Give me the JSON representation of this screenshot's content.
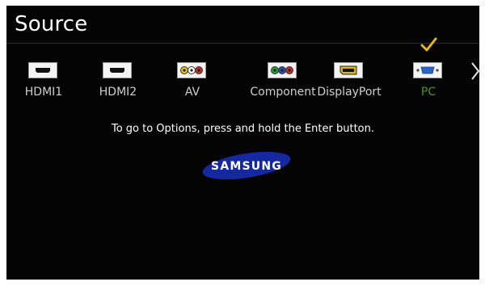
{
  "app": {
    "title": "Source"
  },
  "sources": [
    {
      "label": "HDMI1",
      "icon": "hdmi-port-icon",
      "selected": false
    },
    {
      "label": "HDMI2",
      "icon": "hdmi-port-icon",
      "selected": false
    },
    {
      "label": "AV",
      "icon": "av-rca-icon",
      "selected": false
    },
    {
      "label": "Component",
      "icon": "component-rca-icon",
      "selected": false
    },
    {
      "label": "DisplayPort",
      "icon": "displayport-icon",
      "selected": false
    },
    {
      "label": "PC",
      "icon": "vga-port-icon",
      "selected": true
    }
  ],
  "navigation": {
    "next_icon": "chevron-right-icon"
  },
  "message": "To go to Options, press and hold the Enter button.",
  "logo": {
    "text": "SAMSUNG"
  },
  "colors": {
    "background": "#040404",
    "selected_text": "#5a8f22",
    "check": "#e5b71c",
    "logo_blue": "#1428a0"
  }
}
